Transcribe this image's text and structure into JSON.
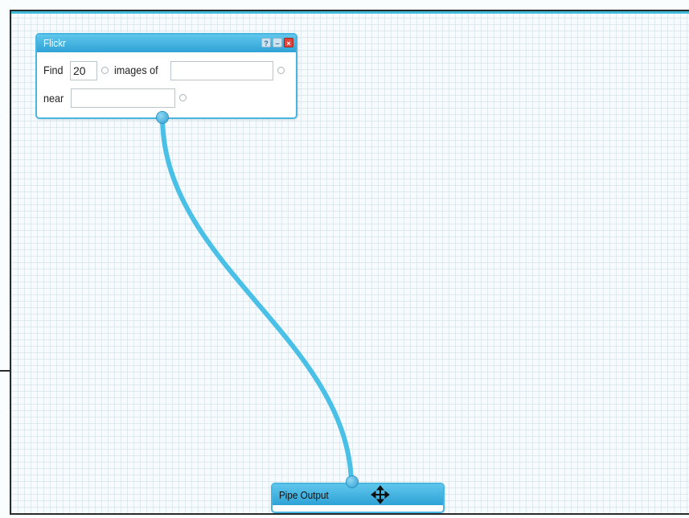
{
  "flickr_module": {
    "title": "Flickr",
    "buttons": {
      "help": "?",
      "minimize": "–",
      "close": "×"
    },
    "find_label": "Find",
    "find_count": "20",
    "images_of_label": "images of",
    "images_of_value": "",
    "near_label": "near",
    "near_value": ""
  },
  "output_module": {
    "title": "Pipe Output"
  },
  "colors": {
    "wire": "#4ac0e6",
    "titlebar": "#2ea2d6",
    "frame_border": "#49b6e0"
  }
}
